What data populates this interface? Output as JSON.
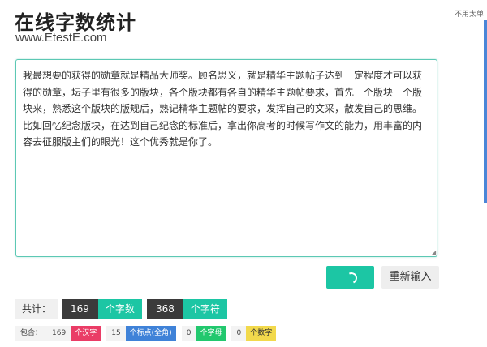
{
  "header": {
    "title": "在线字数统计",
    "url": "www.EtestE.com",
    "side_note": "不用太单"
  },
  "editor": {
    "text": "我最想要的获得的勋章就是精品大师奖。顾名思义，就是精华主题帖子达到一定程度才可以获得的勋章，坛子里有很多的版块，各个版块都有各自的精华主题帖要求，首先一个版块一个版块来，熟悉这个版块的版规后，熟记精华主题帖的要求，发挥自己的文采，散发自己的思维。比如回忆纪念版块，在达到自己纪念的标准后，拿出你高考的时候写作文的能力，用丰富的内容去征服版主们的眼光！这个优秀就是你了。"
  },
  "buttons": {
    "submit_icon": "spinner-icon",
    "reset_label": "重新输入"
  },
  "totals": {
    "label": "共计：",
    "chars_value": "169",
    "chars_unit": "个字数",
    "symbols_value": "368",
    "symbols_unit": "个字符"
  },
  "details": {
    "label": "包含：",
    "hanzi_count": "169",
    "hanzi_tag": "个汉字",
    "punct_count": "15",
    "punct_tag": "个标点(全角)",
    "letter_count": "0",
    "letter_tag": "个字母",
    "digit_count": "0",
    "digit_tag": "个数字"
  },
  "colors": {
    "accent": "#1cc6a4",
    "dark": "#3b3b3b",
    "red": "#ea3c66",
    "blue": "#3f82d8",
    "green": "#22c86e",
    "yellow": "#f2d94c"
  }
}
